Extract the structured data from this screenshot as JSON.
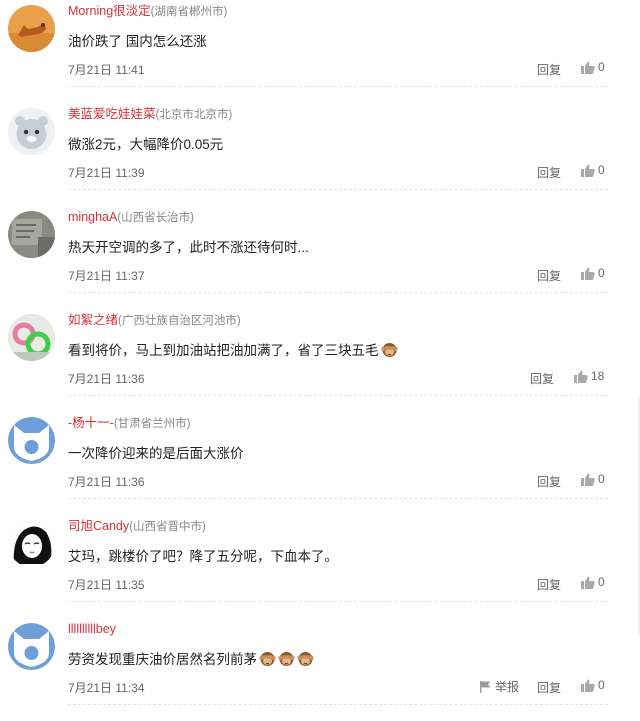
{
  "comments": [
    {
      "name": "Morning很淡定",
      "location": "(湖南省郴州市)",
      "text": "油价跌了 国内怎么还涨",
      "time": "7月21日 11:41",
      "reply": "回复",
      "likes": "0",
      "emoji_count": 0,
      "avatar": "fox"
    },
    {
      "name": "美蓝爱吃娃娃菜",
      "location": "(北京市北京市)",
      "text": "微涨2元，大幅降价0.05元",
      "time": "7月21日 11:39",
      "reply": "回复",
      "likes": "0",
      "emoji_count": 0,
      "avatar": "cartoon"
    },
    {
      "name": "minghaA",
      "location": "(山西省长治市)",
      "text": "热天开空调的多了，此时不涨还待何时...",
      "time": "7月21日 11:37",
      "reply": "回复",
      "likes": "0",
      "emoji_count": 0,
      "avatar": "photo"
    },
    {
      "name": "如絮之绪",
      "location": "(广西壮族自治区河池市)",
      "text": "看到将价，马上到加油站把油加满了，省了三块五毛",
      "time": "7月21日 11:36",
      "reply": "回复",
      "likes": "18",
      "emoji_count": 1,
      "avatar": "rings"
    },
    {
      "name": "-杨十一-",
      "location": "(甘肃省兰州市)",
      "text": "一次降价迎来的是后面大涨价",
      "time": "7月21日 11:36",
      "reply": "回复",
      "likes": "0",
      "emoji_count": 0,
      "avatar": "default"
    },
    {
      "name": "司旭Candy",
      "location": "(山西省晋中市)",
      "text": "艾玛，跳楼价了吧？降了五分呢，下血本了。",
      "time": "7月21日 11:35",
      "reply": "回复",
      "likes": "0",
      "emoji_count": 0,
      "avatar": "sketch"
    },
    {
      "name": "llllllllllbey",
      "location": "",
      "text": "劳资发现重庆油价居然名列前茅",
      "time": "7月21日 11:34",
      "reply": "回复",
      "likes": "0",
      "emoji_count": 3,
      "avatar": "default",
      "report": "举报"
    }
  ]
}
